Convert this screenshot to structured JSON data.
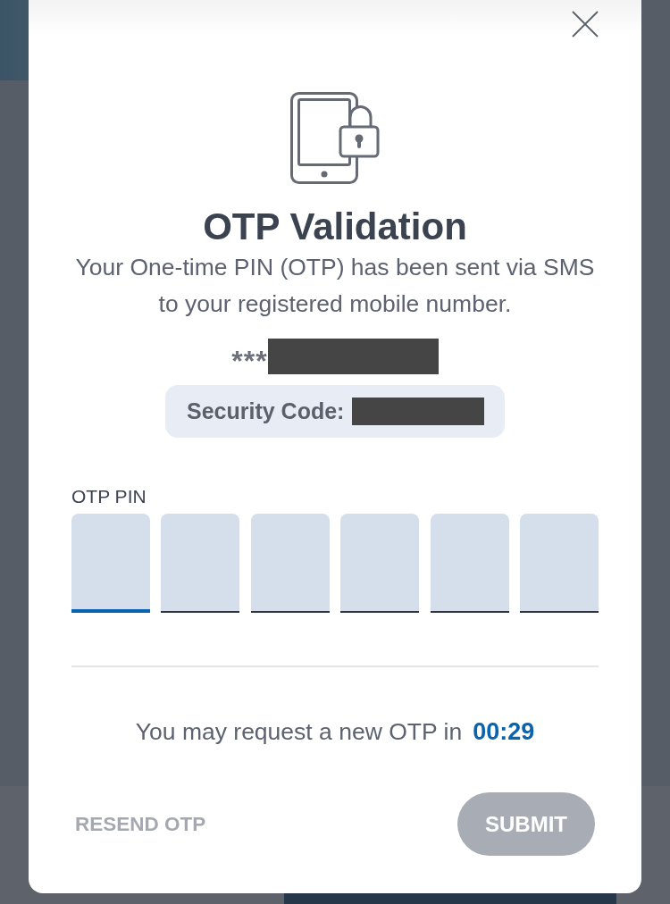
{
  "dialog": {
    "title": "OTP Validation",
    "message": "Your One-time PIN (OTP) has been sent via SMS to your registered mobile number."
  },
  "recipient": {
    "masked_prefix": "***",
    "redacted": true
  },
  "security_code": {
    "label": "Security Code:",
    "redacted": true
  },
  "pin": {
    "label": "OTP PIN",
    "boxes": [
      {
        "focused": true
      },
      {
        "focused": false
      },
      {
        "focused": false
      },
      {
        "focused": false
      },
      {
        "focused": false
      },
      {
        "focused": false
      }
    ]
  },
  "timer": {
    "text": "You may request a new OTP in",
    "countdown": "00:29"
  },
  "buttons": [
    {
      "label": "RESEND OTP",
      "kind": "text",
      "disabled": true
    },
    {
      "label": "SUBMIT",
      "kind": "pill",
      "disabled": true
    }
  ]
}
